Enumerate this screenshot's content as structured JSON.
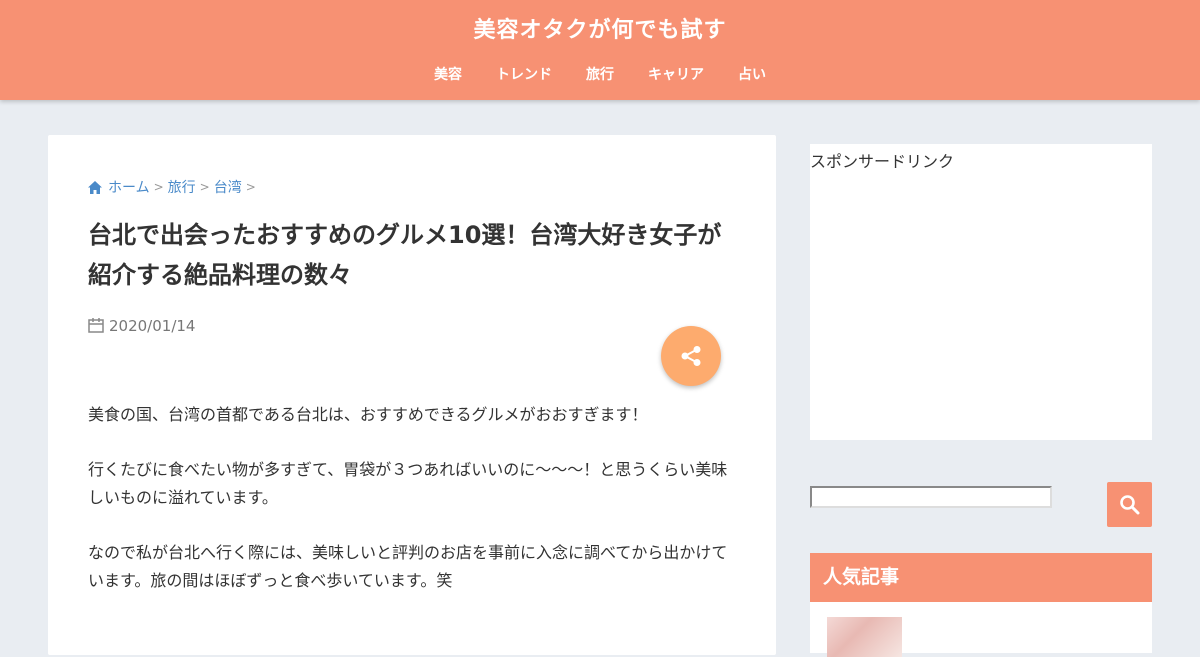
{
  "header": {
    "site_title": "美容オタクが何でも試す",
    "nav": [
      "美容",
      "トレンド",
      "旅行",
      "キャリア",
      "占い"
    ]
  },
  "article": {
    "breadcrumb": [
      "ホーム",
      "旅行",
      "台湾"
    ],
    "title": "台北で出会ったおすすめのグルメ10選！台湾大好き女子が紹介する絶品料理の数々",
    "date": "2020/01/14",
    "paragraphs": [
      "美食の国、台湾の首都である台北は、おすすめできるグルメがおおすぎます！",
      "行くたびに食べたい物が多すぎて、胃袋が３つあればいいのに〜〜〜！と思うくらい美味しいものに溢れています。",
      "なので私が台北へ行く際には、美味しいと評判のお店を事前に入念に調べてから出かけています。旅の間はほぼずっと食べ歩いています。笑"
    ]
  },
  "sidebar": {
    "ad_label": "スポンサードリンク",
    "search_placeholder": "",
    "popular_heading": "人気記事"
  },
  "colors": {
    "accent": "#f79173",
    "share": "#fdab6e",
    "link": "#4a8ac9",
    "background": "#e9edf2"
  },
  "icons": {
    "home": "home-icon",
    "calendar": "calendar-icon",
    "share": "share-icon",
    "search": "search-icon"
  }
}
